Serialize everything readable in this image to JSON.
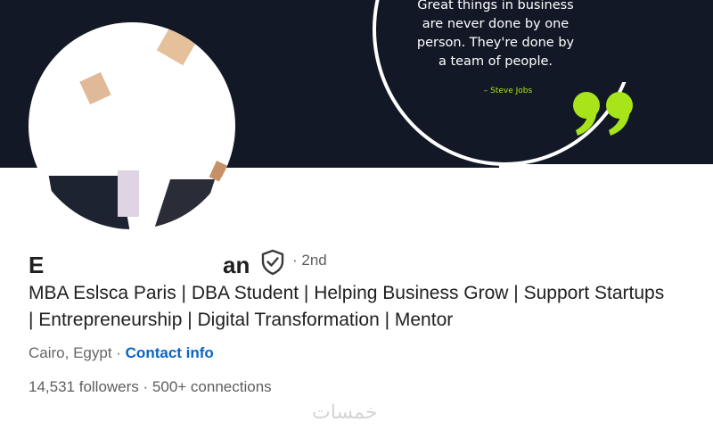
{
  "banner": {
    "quote_lines": [
      "Great things in business",
      "are never done by one",
      "person. They're done by",
      "a team of people."
    ],
    "quote_author": "– Steve Jobs",
    "accent_color": "#a8e41a",
    "background_color": "#121826"
  },
  "profile": {
    "name_first": "E",
    "name_last": "an",
    "verified_icon": "shield-check-icon",
    "degree": "· 2nd",
    "headline": "MBA Eslsca Paris | DBA Student | Helping Business Grow | Support Startups | Entrepreneurship | Digital Transformation | Mentor",
    "location": "Cairo, Egypt",
    "separator": " · ",
    "contact_info": "Contact info",
    "followers": "14,531 followers",
    "stats_separator": " · ",
    "connections": "500+ connections",
    "link_color": "#0a66c2"
  },
  "watermark": "خمسات"
}
